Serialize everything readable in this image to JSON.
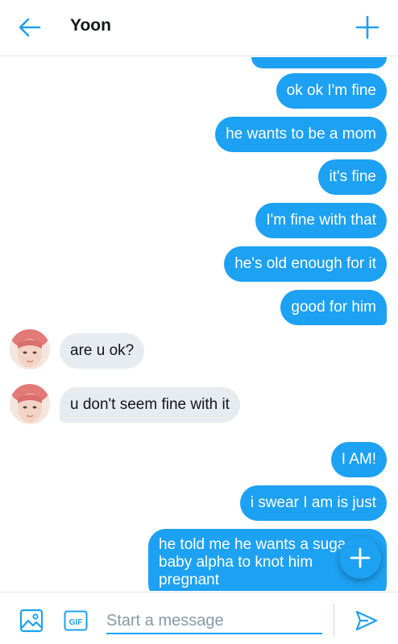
{
  "header": {
    "title": "Yoon",
    "back_icon": "arrow-left-icon",
    "new_icon": "plus-icon"
  },
  "messages": [
    {
      "from": "me",
      "text": "ok ok I'm fine"
    },
    {
      "from": "me",
      "text": "he wants to be a mom"
    },
    {
      "from": "me",
      "text": "it's fine"
    },
    {
      "from": "me",
      "text": "I'm fine with that"
    },
    {
      "from": "me",
      "text": "he's old enough for it"
    },
    {
      "from": "me",
      "text": "good for him"
    },
    {
      "from": "them",
      "text": "are u ok?"
    },
    {
      "from": "them",
      "text": "u don't seem fine with it"
    },
    {
      "from": "me",
      "text": "I AM!"
    },
    {
      "from": "me",
      "text": "i swear I am is just"
    },
    {
      "from": "me",
      "lines": [
        "he told me he wants a suga",
        "baby alpha to knot him",
        "pregnant"
      ]
    }
  ],
  "composer": {
    "placeholder": "Start a message",
    "gif_label": "GIF"
  },
  "colors": {
    "accent": "#1da1f2",
    "incoming_bubble": "#e6ecf0",
    "text": "#14171a",
    "muted": "#8899a6"
  }
}
